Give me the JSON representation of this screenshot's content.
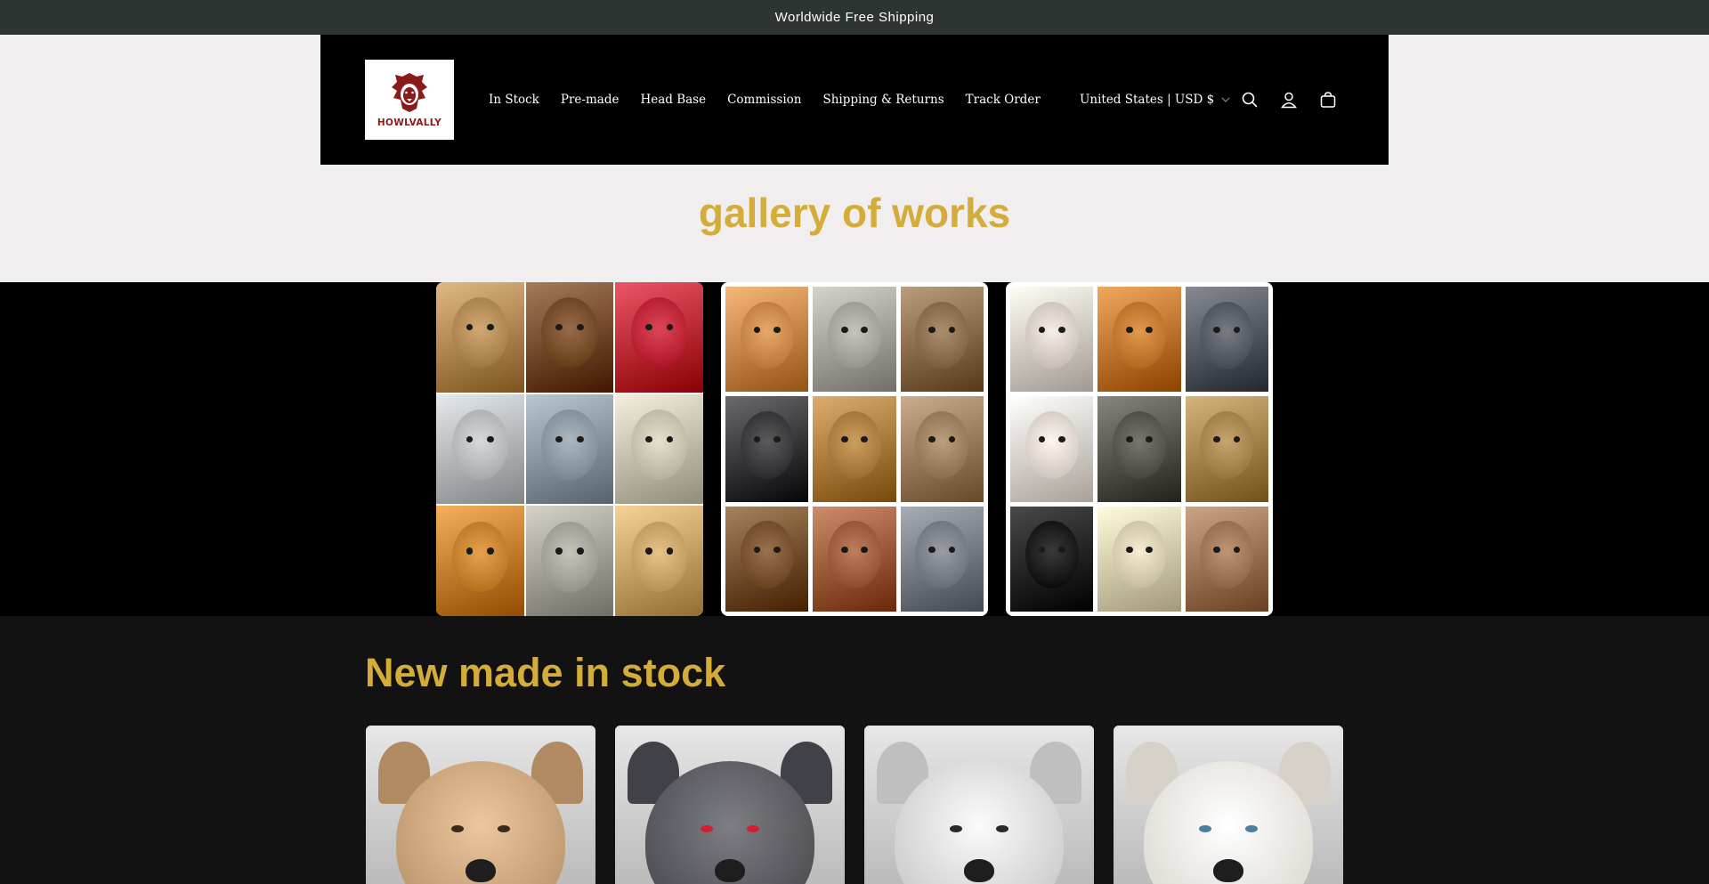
{
  "announcement": {
    "text": "Worldwide Free Shipping"
  },
  "header": {
    "logo_text": "HOWLVALLY",
    "nav": [
      {
        "label": "In Stock"
      },
      {
        "label": "Pre-made"
      },
      {
        "label": "Head Base"
      },
      {
        "label": "Commission"
      },
      {
        "label": "Shipping & Returns"
      },
      {
        "label": "Track Order"
      }
    ],
    "locale": "United States | USD $",
    "icons": [
      "search-icon",
      "account-icon",
      "cart-icon"
    ]
  },
  "gallery": {
    "title": "gallery of works",
    "collages": [
      {
        "tiles": [
          "#b48a56",
          "#7a4e2a",
          "#c0283a",
          "#b9bcbf",
          "#8e9aa3",
          "#c8c2b0",
          "#c9822f",
          "#a7a59c",
          "#c9a56a"
        ]
      },
      {
        "tiles": [
          "#c98a4b",
          "#a9a6a0",
          "#8c7050",
          "#3d3d40",
          "#b08040",
          "#9c8060",
          "#7a5530",
          "#a06040",
          "#7a7f88"
        ]
      },
      {
        "tiles": [
          "#d8d0c8",
          "#c47a30",
          "#595d66",
          "#e0d8d0",
          "#5a5850",
          "#a88850",
          "#1c1c1c",
          "#d8cfb0",
          "#a07858"
        ]
      }
    ]
  },
  "stock": {
    "title": "New made in stock",
    "products": [
      {
        "color": "#c9a47a"
      },
      {
        "color": "#5a5b60"
      },
      {
        "color": "#d8d8d8"
      },
      {
        "color": "#efeae2"
      }
    ]
  }
}
